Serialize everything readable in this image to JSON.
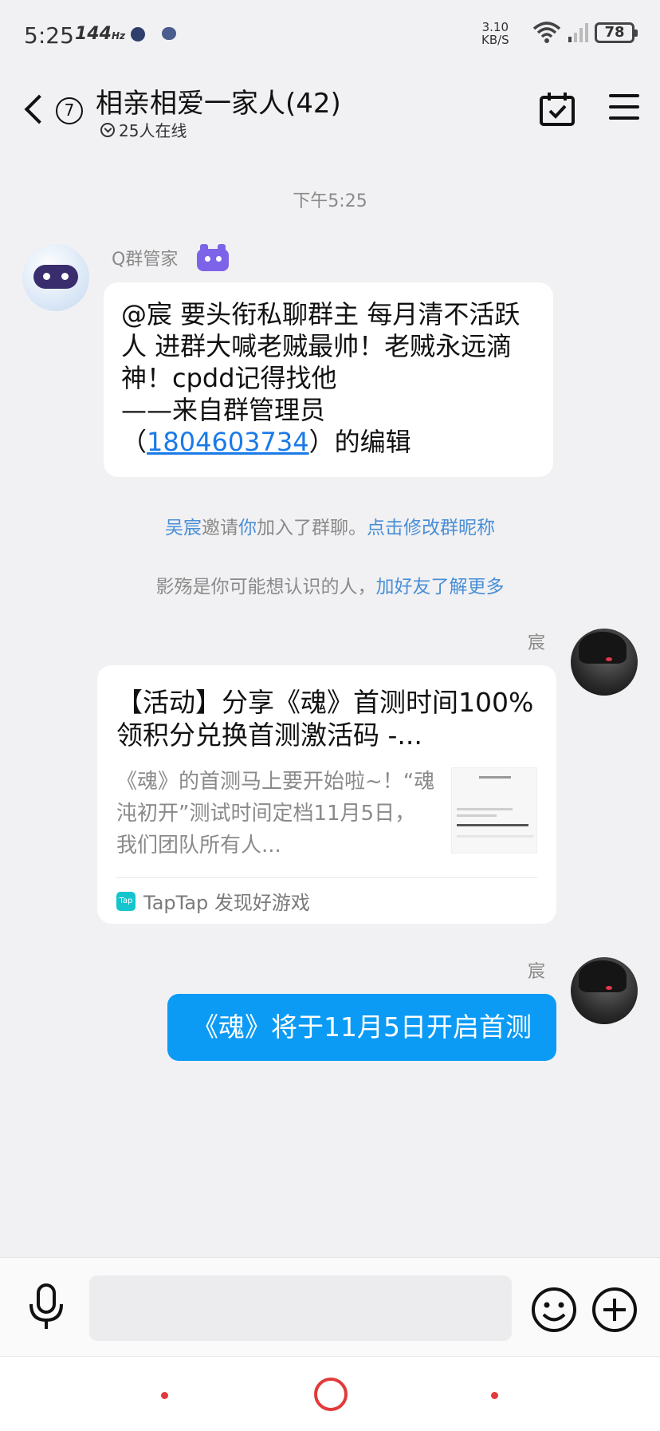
{
  "status_bar": {
    "time": "5:25",
    "refresh_rate": "144",
    "refresh_unit": "Hz",
    "net_speed_value": "3.10",
    "net_speed_unit": "KB/S",
    "battery": "78"
  },
  "header": {
    "unread_count": "7",
    "group_title": "相亲相爱一家人(42)",
    "online_text": "25人在线"
  },
  "chat": {
    "timestamp": "下午5:25",
    "bot_message": {
      "sender": "Q群管家",
      "text_main": "@宸 要头衔私聊群主 每月清不活跃人 进群大喊老贼最帅！老贼永远滴神！cpdd记得找他",
      "text_signature": "——来自群管理员",
      "text_open_paren": "（",
      "phone_link": "1804603734",
      "text_suffix": "）的编辑"
    },
    "system_invite": {
      "inviter": "吴宸",
      "invite_verb": "邀请",
      "invitee": "你",
      "invite_end": "加入了群聊。",
      "edit_nick_link": "点击修改群昵称"
    },
    "system_suggest": {
      "text": "影殇是你可能想认识的人，",
      "link": "加好友了解更多"
    },
    "share_card": {
      "sender": "宸",
      "title": "【活动】分享《魂》首测时间100%领积分兑换首测激活码 -...",
      "summary": "《魂》的首测马上要开始啦~！“魂沌初开”测试时间定档11月5日，我们团队所有人...",
      "source_icon_text": "Tap",
      "source": "TapTap 发现好游戏"
    },
    "my_message": {
      "sender": "宸",
      "text": "《魂》将于11月5日开启首测"
    }
  },
  "input_bar": {
    "input_value": ""
  },
  "icons": {
    "back": "chevron-left-icon",
    "calendar": "calendar-check-icon",
    "menu": "hamburger-menu-icon",
    "mic": "microphone-icon",
    "emoji": "smiley-icon",
    "plus": "plus-circle-icon"
  },
  "colors": {
    "accent_blue": "#0b9bf5",
    "link_blue": "#4a8fd6",
    "bot_purple": "#7d63e8",
    "nav_red": "#e23a3a"
  }
}
